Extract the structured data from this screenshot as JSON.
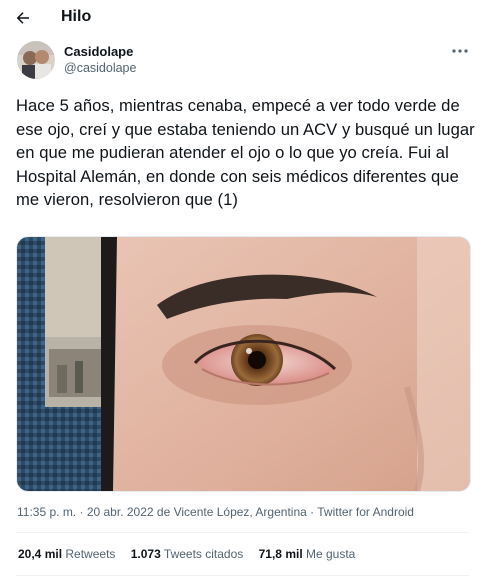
{
  "header": {
    "title": "Hilo",
    "back_icon": "arrow-left-icon"
  },
  "author": {
    "name": "Casidolape",
    "handle": "@casidolape",
    "more_icon": "more-horizontal-icon"
  },
  "tweet": {
    "text": "Hace 5 años, mientras cenaba, empecé a ver todo verde de ese ojo, creí y que estaba teniendo un ACV y busqué un lugar en que me pudieran atender el ojo o lo que yo creía. Fui al Hospital Alemán, en donde con seis médicos diferentes que me vieron, resolvieron que (1)"
  },
  "meta": {
    "time": "11:35 p. m.",
    "separator": " · ",
    "date": "20 abr. 2022",
    "location_prefix": " de ",
    "location": "Vicente López, Argentina",
    "source": "Twitter for Android"
  },
  "stats": {
    "retweets_count": "20,4 mil",
    "retweets_label": "Retweets",
    "quotes_count": "1.073",
    "quotes_label": "Tweets citados",
    "likes_count": "71,8 mil",
    "likes_label": "Me gusta"
  },
  "colors": {
    "text": "#0f1419",
    "secondary": "#536471",
    "divider": "#eff3f4"
  }
}
